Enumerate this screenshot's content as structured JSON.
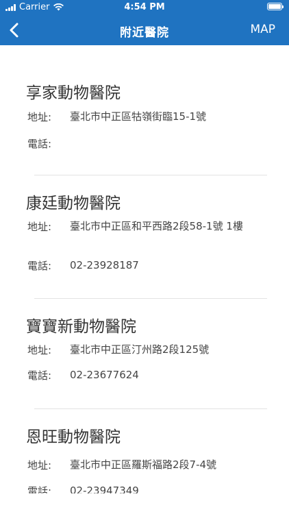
{
  "status_bar": {
    "carrier": "Carrier",
    "time": "4:54 PM",
    "signal_icon": "signal-bars-icon",
    "wifi_icon": "wifi-icon",
    "battery_icon": "battery-full-icon"
  },
  "nav": {
    "title": "附近醫院",
    "map_label": "MAP",
    "back_icon": "chevron-left-icon"
  },
  "labels": {
    "address": "地址:",
    "phone": "電話:"
  },
  "clinics": [
    {
      "name": "享家動物醫院",
      "address": "臺北市中正區牯嶺街臨15-1號",
      "phone": ""
    },
    {
      "name": "康廷動物醫院",
      "address": "臺北市中正區和平西路2段58-1號 1樓",
      "phone": "02-23928187"
    },
    {
      "name": "寶寶新動物醫院",
      "address": "臺北市中正區汀州路2段125號",
      "phone": "02-23677624"
    },
    {
      "name": "恩旺動物醫院",
      "address": "臺北市中正區羅斯福路2段7-4號",
      "phone": "02-23947349"
    }
  ],
  "colors": {
    "header_background": "#1f73c1",
    "header_text": "#ffffff",
    "body_text": "#444444",
    "divider": "#e3e3e3"
  }
}
